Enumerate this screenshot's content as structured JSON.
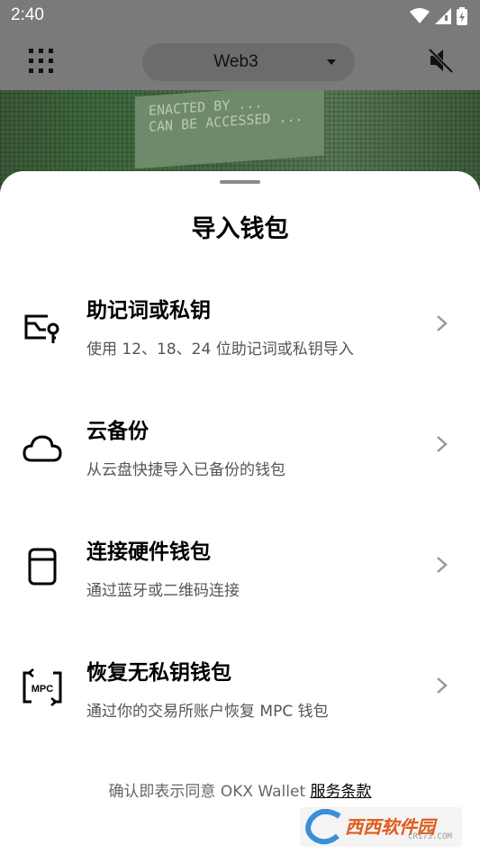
{
  "status_bar": {
    "time": "2:40"
  },
  "top_bar": {
    "network_label": "Web3"
  },
  "banner": {
    "text_line1": "ENACTED BY ...",
    "text_line2": "CAN BE ACCESSED ..."
  },
  "sheet": {
    "title": "导入钱包",
    "options": [
      {
        "title": "助记词或私钥",
        "subtitle": "使用 12、18、24 位助记词或私钥导入",
        "icon": "seed-phrase-key-icon"
      },
      {
        "title": "云备份",
        "subtitle": "从云盘快捷导入已备份的钱包",
        "icon": "cloud-icon"
      },
      {
        "title": "连接硬件钱包",
        "subtitle": "通过蓝牙或二维码连接",
        "icon": "hardware-wallet-icon"
      },
      {
        "title": "恢复无私钥钱包",
        "subtitle": "通过你的交易所账户恢复 MPC 钱包",
        "icon": "mpc-icon"
      }
    ],
    "terms_prefix": "确认即表示同意 OKX Wallet ",
    "terms_link": "服务条款"
  },
  "watermark": {
    "text": "西西软件园",
    "sub": "CR173.COM"
  },
  "colors": {
    "sheet_bg": "#ffffff",
    "title": "#000000",
    "subtitle": "#555555",
    "overlay": "#7a7a7a"
  }
}
